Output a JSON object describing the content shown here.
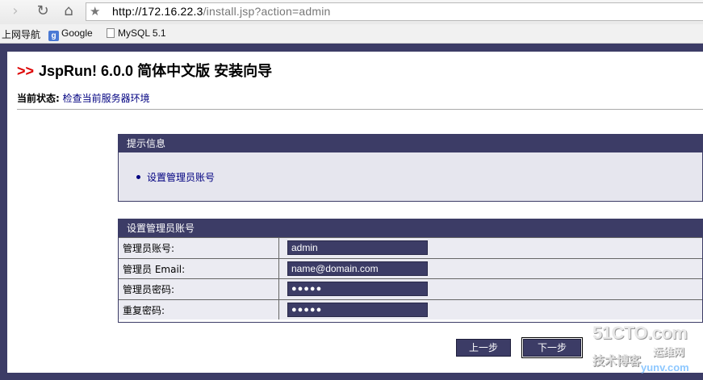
{
  "browser": {
    "url_host": "http://172.16.22.3",
    "url_path": "/install.jsp?action=admin",
    "bookmarks": [
      {
        "label": "上网导航"
      },
      {
        "label": "Google"
      },
      {
        "label": "MySQL 5.1"
      }
    ]
  },
  "header": {
    "arrow": ">>",
    "title": "JspRun! 6.0.0 简体中文版 安装向导",
    "status_label": "当前状态:",
    "status_value": "检查当前服务器环境"
  },
  "tip_panel": {
    "heading": "提示信息",
    "item": "设置管理员账号"
  },
  "form_panel": {
    "heading": "设置管理员账号",
    "fields": [
      {
        "label": "管理员账号:",
        "value": "admin"
      },
      {
        "label": "管理员  Email:",
        "value": "name@domain.com"
      },
      {
        "label": "管理员密码:",
        "value": "●●●●●"
      },
      {
        "label": "重复密码:",
        "value": "●●●●●"
      }
    ]
  },
  "buttons": {
    "prev": "上一步",
    "next": "下一步"
  },
  "watermark": {
    "line1": "51CTO.com",
    "line2": "技术博客",
    "line3": "运维网",
    "url": "yunv.com"
  },
  "colors": {
    "accent": "#3c3c66",
    "arrow": "#dd0000",
    "link": "#000080"
  }
}
